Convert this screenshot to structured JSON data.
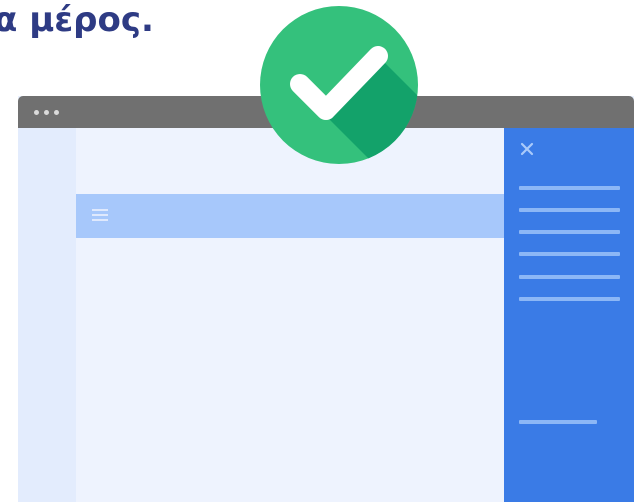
{
  "heading": {
    "text": "α μέρος."
  },
  "window": {
    "titlebar_dots": [
      "dot",
      "dot",
      "dot"
    ],
    "menu_icon": "hamburger-menu-icon",
    "side_panel": {
      "close_icon": "close-icon",
      "lines": [
        "line",
        "line",
        "line",
        "line",
        "line",
        "line",
        "line"
      ]
    }
  },
  "badge": {
    "icon": "checkmark-icon"
  },
  "colors": {
    "heading": "#2e3b84",
    "titlebar": "#707070",
    "page_background": "#eaf1fe",
    "highlight_bar": "#a7c8fb",
    "side_panel": "#3a7be6",
    "panel_lines": "#8cb7f6",
    "badge_green": "#34c17c",
    "badge_shadow": "#13a26a"
  }
}
